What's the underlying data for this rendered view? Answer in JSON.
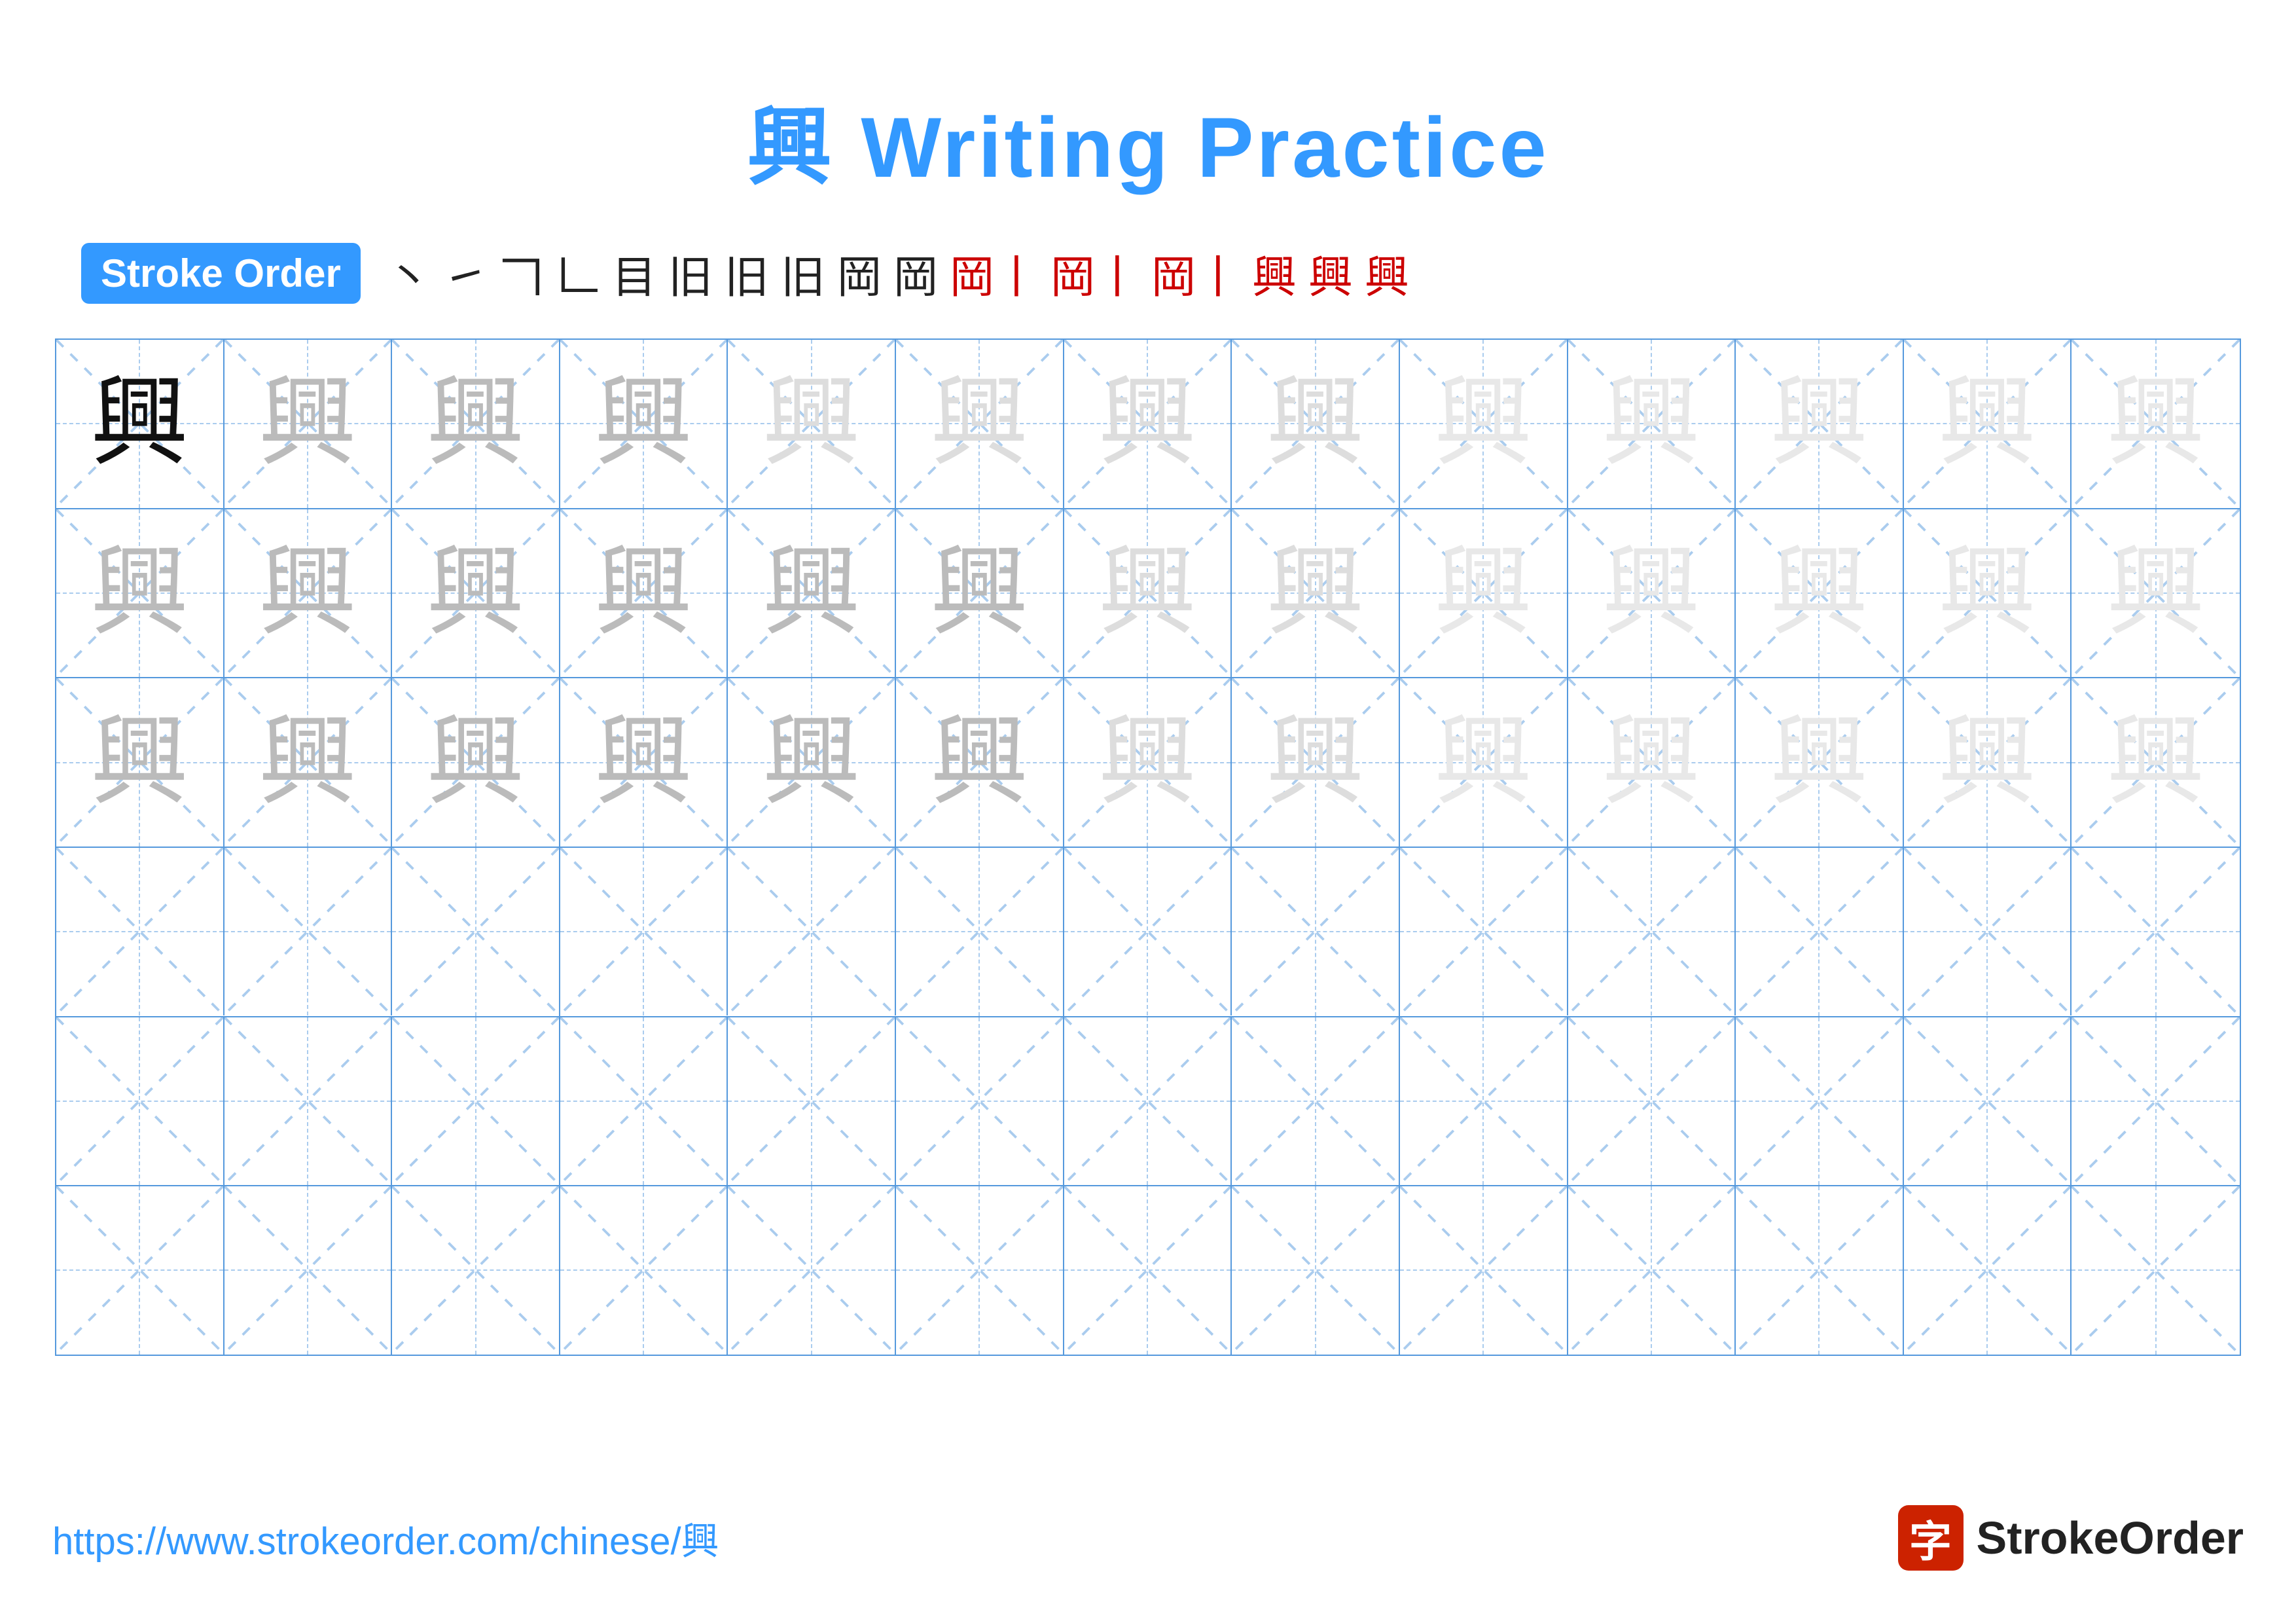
{
  "title": {
    "char": "興",
    "text": " Writing Practice"
  },
  "stroke_order": {
    "badge": "Stroke Order",
    "steps": [
      "丶",
      "㇀",
      "𠃍",
      "𠃊",
      "目",
      "目𠃌",
      "目𠃌丨",
      "目𠃌丨一",
      "興bottom",
      "興-",
      "興|",
      "興㇏",
      "興㇏㇀",
      "興",
      "興+",
      "興"
    ]
  },
  "character": "興",
  "url": "https://www.strokeorder.com/chinese/興",
  "logo_text": "StrokeOrder",
  "rows": [
    {
      "type": "practice",
      "cells": [
        {
          "opacity": "dark"
        },
        {
          "opacity": "medium"
        },
        {
          "opacity": "medium"
        },
        {
          "opacity": "medium"
        },
        {
          "opacity": "light"
        },
        {
          "opacity": "light"
        },
        {
          "opacity": "light"
        },
        {
          "opacity": "light"
        },
        {
          "opacity": "very-light"
        },
        {
          "opacity": "very-light"
        },
        {
          "opacity": "very-light"
        },
        {
          "opacity": "very-light"
        },
        {
          "opacity": "very-light"
        }
      ]
    },
    {
      "type": "practice",
      "cells": [
        {
          "opacity": "medium"
        },
        {
          "opacity": "medium"
        },
        {
          "opacity": "medium"
        },
        {
          "opacity": "medium"
        },
        {
          "opacity": "medium"
        },
        {
          "opacity": "medium"
        },
        {
          "opacity": "light"
        },
        {
          "opacity": "light"
        },
        {
          "opacity": "very-light"
        },
        {
          "opacity": "very-light"
        },
        {
          "opacity": "very-light"
        },
        {
          "opacity": "very-light"
        },
        {
          "opacity": "very-light"
        }
      ]
    },
    {
      "type": "practice",
      "cells": [
        {
          "opacity": "medium"
        },
        {
          "opacity": "medium"
        },
        {
          "opacity": "medium"
        },
        {
          "opacity": "medium"
        },
        {
          "opacity": "medium"
        },
        {
          "opacity": "medium"
        },
        {
          "opacity": "light"
        },
        {
          "opacity": "light"
        },
        {
          "opacity": "very-light"
        },
        {
          "opacity": "very-light"
        },
        {
          "opacity": "very-light"
        },
        {
          "opacity": "very-light"
        },
        {
          "opacity": "very-light"
        }
      ]
    },
    {
      "type": "empty"
    },
    {
      "type": "empty"
    },
    {
      "type": "empty"
    }
  ],
  "colors": {
    "blue": "#3399ff",
    "red": "#cc2200",
    "border": "#5599dd",
    "guide": "#aaccee",
    "dark_char": "#111111",
    "medium_char": "#bbbbbb",
    "light_char": "#dddddd",
    "very_light_char": "#e8e8e8"
  }
}
